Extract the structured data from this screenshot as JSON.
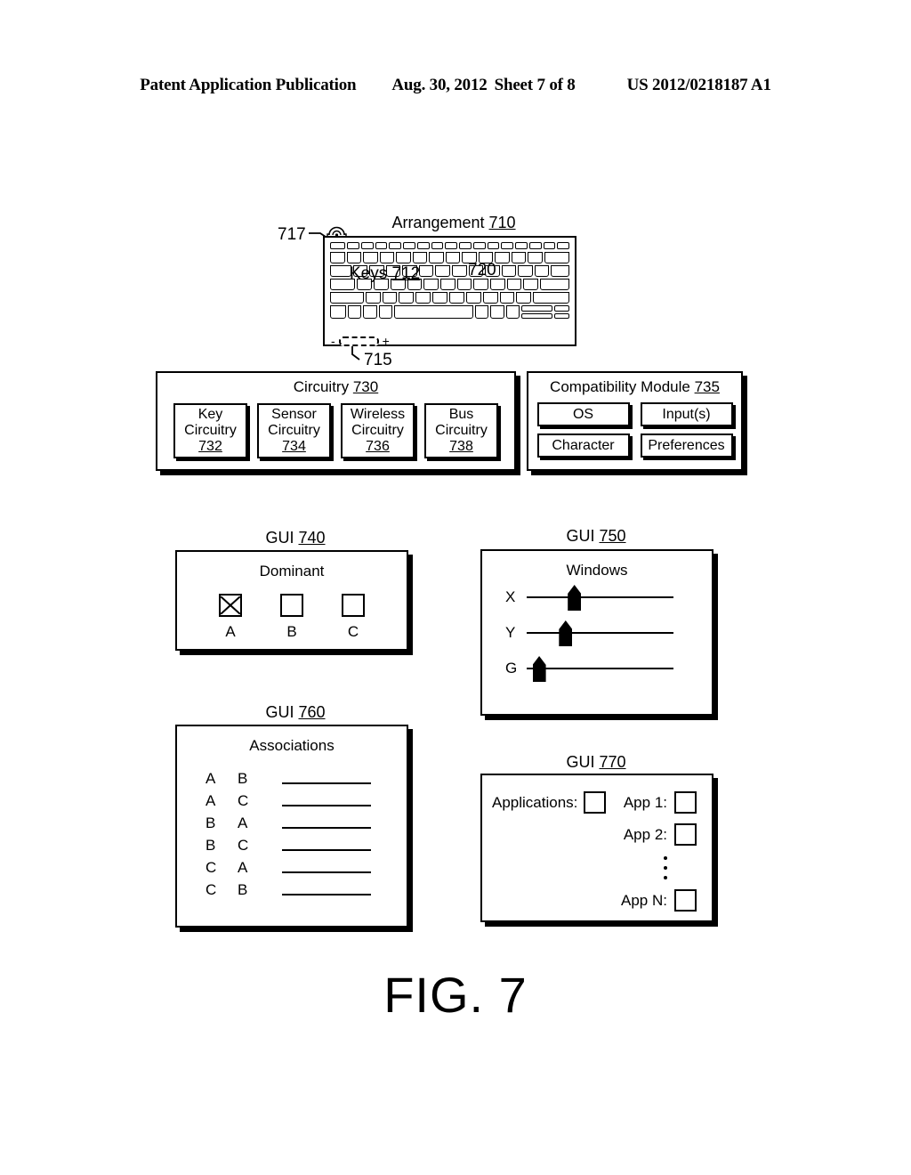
{
  "header": {
    "publication": "Patent Application Publication",
    "date": "Aug. 30, 2012",
    "sheet": "Sheet 7 of 8",
    "patent_number": "US 2012/0218187 A1"
  },
  "figure": {
    "label": "FIG. 7"
  },
  "arrangement": {
    "title_text": "Arrangement",
    "title_ref": "710",
    "keys_text": "Keys",
    "keys_ref": "712",
    "key_callout_ref": "720",
    "battery_ref": "715",
    "battery_minus": "-",
    "battery_plus": "+",
    "sensor_ref": "717"
  },
  "circuitry": {
    "title_text": "Circuitry",
    "title_ref": "730",
    "items": [
      {
        "line1": "Key",
        "line2": "Circuitry",
        "ref": "732"
      },
      {
        "line1": "Sensor",
        "line2": "Circuitry",
        "ref": "734"
      },
      {
        "line1": "Wireless",
        "line2": "Circuitry",
        "ref": "736"
      },
      {
        "line1": "Bus",
        "line2": "Circuitry",
        "ref": "738"
      }
    ]
  },
  "compatibility_module": {
    "title_text": "Compatibility Module",
    "title_ref": "735",
    "items": [
      {
        "label": "OS"
      },
      {
        "label": "Input(s)"
      },
      {
        "label": "Character"
      },
      {
        "label": "Preferences"
      }
    ]
  },
  "gui740": {
    "caption_text": "GUI",
    "caption_ref": "740",
    "title": "Dominant",
    "options": [
      {
        "label": "A",
        "checked": true
      },
      {
        "label": "B",
        "checked": false
      },
      {
        "label": "C",
        "checked": false
      }
    ]
  },
  "gui750": {
    "caption_text": "GUI",
    "caption_ref": "750",
    "title": "Windows",
    "sliders": [
      {
        "label": "X",
        "value_percent": 28
      },
      {
        "label": "Y",
        "value_percent": 22
      },
      {
        "label": "G",
        "value_percent": 4
      }
    ]
  },
  "gui760": {
    "caption_text": "GUI",
    "caption_ref": "760",
    "title": "Associations",
    "rows": [
      {
        "from": "A",
        "to": "B",
        "value": ""
      },
      {
        "from": "A",
        "to": "C",
        "value": ""
      },
      {
        "from": "B",
        "to": "A",
        "value": ""
      },
      {
        "from": "B",
        "to": "C",
        "value": ""
      },
      {
        "from": "C",
        "to": "A",
        "value": ""
      },
      {
        "from": "C",
        "to": "B",
        "value": ""
      }
    ]
  },
  "gui770": {
    "caption_text": "GUI",
    "caption_ref": "770",
    "applications_label": "Applications:",
    "apps": [
      {
        "label": "App 1:",
        "checked": false
      },
      {
        "label": "App 2:",
        "checked": false
      },
      {
        "label": "App N:",
        "checked": false
      }
    ],
    "ellipsis": "⋮"
  },
  "colors": {
    "ink": "#000000",
    "paper": "#ffffff"
  }
}
